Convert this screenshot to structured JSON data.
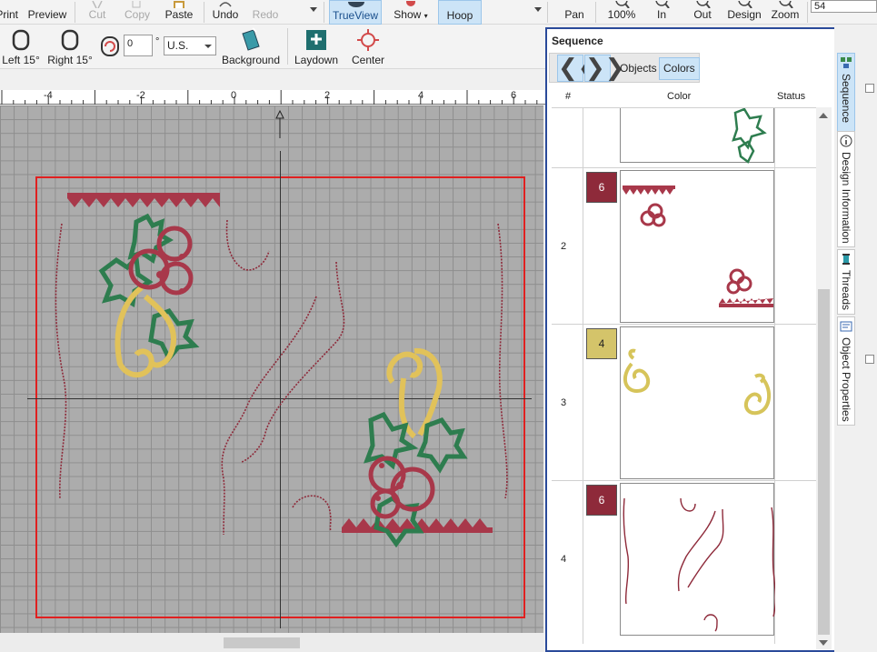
{
  "toolbar1": {
    "print": "Print",
    "preview": "Preview",
    "cut": "Cut",
    "copy": "Copy",
    "paste": "Paste",
    "undo": "Undo",
    "redo": "Redo",
    "trueview": "TrueView",
    "show": "Show",
    "hoop": "Hoop",
    "pan": "Pan",
    "zoom100": "100%",
    "zoom_in": "In",
    "zoom_out": "Out",
    "design": "Design",
    "zoom": "Zoom",
    "zoom_value": "54"
  },
  "toolbar2": {
    "left15": "Left 15°",
    "right15": "Right 15°",
    "angle_value": "0",
    "degree_symbol": "°",
    "units": "U.S.",
    "background": "Background",
    "laydown": "Laydown",
    "center": "Center"
  },
  "ruler": {
    "labels": [
      "-4",
      "-2",
      "0",
      "2",
      "4",
      "6"
    ]
  },
  "sequence": {
    "title": "Sequence",
    "tabs": [
      "Objects",
      "Colors"
    ],
    "active_tab": "Colors",
    "columns": [
      "#",
      "Color",
      "Status"
    ],
    "rows": [
      {
        "num": "",
        "swatch": "",
        "color": ""
      },
      {
        "num": "2",
        "swatch": "6",
        "color": "#8e2a3a"
      },
      {
        "num": "3",
        "swatch": "4",
        "color": "#d4c46a"
      },
      {
        "num": "4",
        "swatch": "6",
        "color": "#8e2a3a"
      }
    ]
  },
  "side_tabs": [
    "Sequence",
    "Design Information",
    "Threads",
    "Object Properties"
  ],
  "colors": {
    "accent": "#cce4f7",
    "hoop": "#e02020",
    "burgundy": "#a8384a",
    "green": "#2e7d4f",
    "gold": "#e1c25a"
  }
}
